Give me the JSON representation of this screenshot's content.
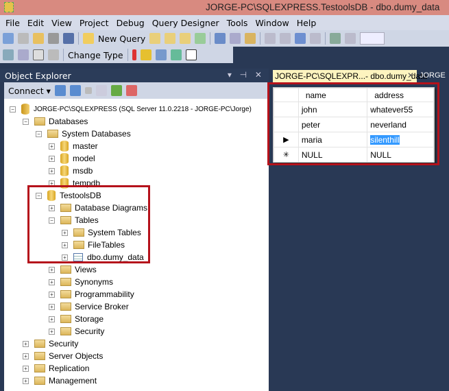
{
  "window": {
    "title": "JORGE-PC\\SQLEXPRESS.TestoolsDB - dbo.dumy_data"
  },
  "menu": [
    "File",
    "Edit",
    "View",
    "Project",
    "Debug",
    "Query Designer",
    "Tools",
    "Window",
    "Help"
  ],
  "toolbar": {
    "new_query": "New Query",
    "change_type": "Change Type"
  },
  "object_explorer": {
    "title": "Object Explorer",
    "controls": "▾ ⊣ ✕",
    "connect": "Connect ▾",
    "tree": [
      {
        "label": "JORGE-PC\\SQLEXPRESS (SQL Server 11.0.2218 - JORGE-PC\\Jorge)",
        "level": 0,
        "icon": "server",
        "state": "-"
      },
      {
        "label": "Databases",
        "level": 1,
        "icon": "folder",
        "state": "-"
      },
      {
        "label": "System Databases",
        "level": 2,
        "icon": "folder",
        "state": "-"
      },
      {
        "label": "master",
        "level": 3,
        "icon": "db",
        "state": "+"
      },
      {
        "label": "model",
        "level": 3,
        "icon": "db",
        "state": "+"
      },
      {
        "label": "msdb",
        "level": 3,
        "icon": "db",
        "state": "+"
      },
      {
        "label": "tempdb",
        "level": 3,
        "icon": "db",
        "state": "+"
      },
      {
        "label": "TestoolsDB",
        "level": 2,
        "icon": "db",
        "state": "-"
      },
      {
        "label": "Database Diagrams",
        "level": 3,
        "icon": "folder",
        "state": "+"
      },
      {
        "label": "Tables",
        "level": 3,
        "icon": "folder",
        "state": "-"
      },
      {
        "label": "System Tables",
        "level": 4,
        "icon": "folder",
        "state": "+"
      },
      {
        "label": "FileTables",
        "level": 4,
        "icon": "folder",
        "state": "+"
      },
      {
        "label": "dbo.dumy_data",
        "level": 4,
        "icon": "table",
        "state": "+"
      },
      {
        "label": "Views",
        "level": 3,
        "icon": "folder",
        "state": "+"
      },
      {
        "label": "Synonyms",
        "level": 3,
        "icon": "folder",
        "state": "+"
      },
      {
        "label": "Programmability",
        "level": 3,
        "icon": "folder",
        "state": "+"
      },
      {
        "label": "Service Broker",
        "level": 3,
        "icon": "folder",
        "state": "+"
      },
      {
        "label": "Storage",
        "level": 3,
        "icon": "folder",
        "state": "+"
      },
      {
        "label": "Security",
        "level": 3,
        "icon": "folder",
        "state": "+"
      },
      {
        "label": "Security",
        "level": 1,
        "icon": "folder",
        "state": "+"
      },
      {
        "label": "Server Objects",
        "level": 1,
        "icon": "folder",
        "state": "+"
      },
      {
        "label": "Replication",
        "level": 1,
        "icon": "folder",
        "state": "+"
      },
      {
        "label": "Management",
        "level": 1,
        "icon": "folder",
        "state": "+"
      }
    ]
  },
  "tabs": {
    "active": "JORGE-PC\\SQLEXPR...- dbo.dumy_data",
    "close": "✕",
    "next": "JORGE"
  },
  "grid": {
    "columns": [
      "name",
      "address"
    ],
    "rows": [
      {
        "marker": "",
        "name": "john",
        "address": "whatever55"
      },
      {
        "marker": "",
        "name": "peter",
        "address": "neverland"
      },
      {
        "marker": "▶",
        "name": "maria",
        "address": "silenthill"
      },
      {
        "marker": "✳",
        "name": "NULL",
        "address": "NULL"
      }
    ]
  }
}
